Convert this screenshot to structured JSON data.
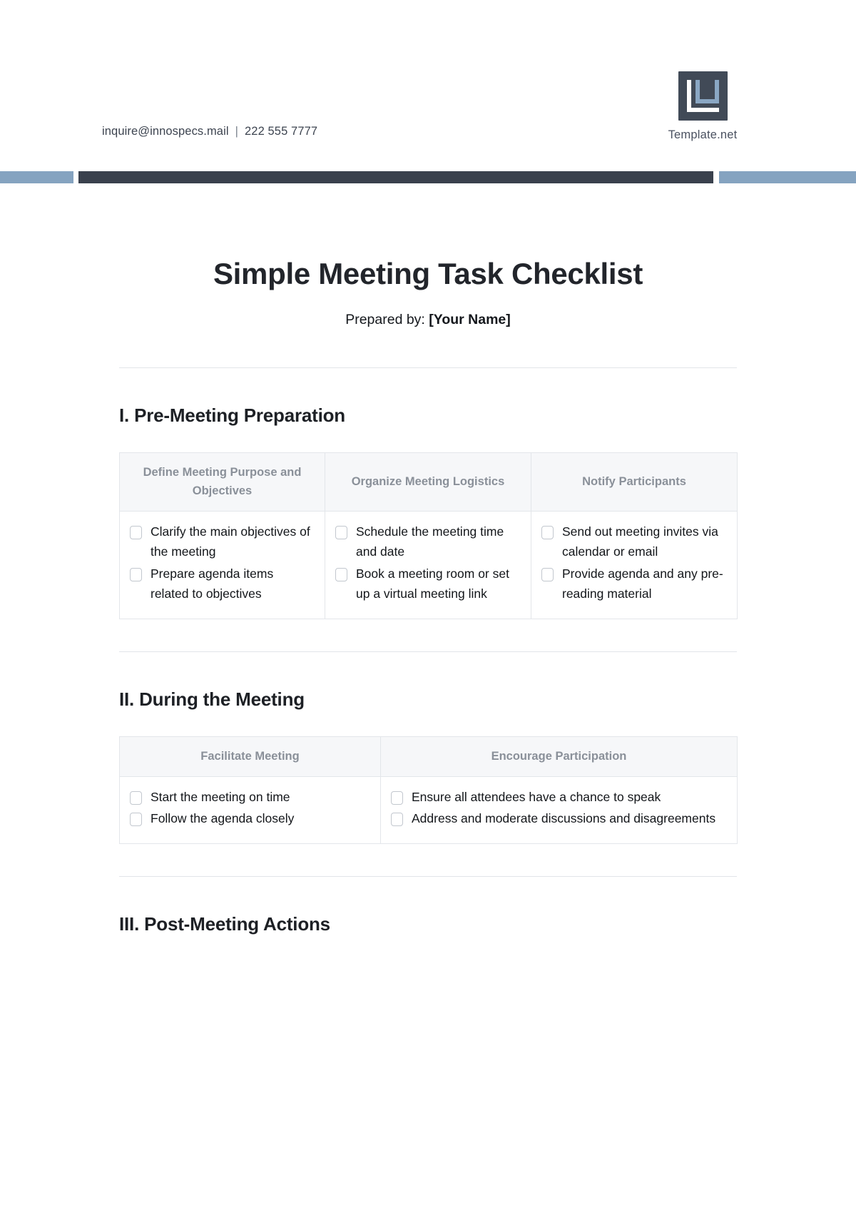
{
  "header": {
    "email": "inquire@innospecs.mail",
    "separator": "|",
    "phone": "222 555 7777",
    "brand_name": "Template.net",
    "logo_icon": "template-net-logo-icon",
    "accent_color": "#85a3c0",
    "dark_color": "#3a414d"
  },
  "document": {
    "title": "Simple Meeting Task Checklist",
    "prepared_by_label": "Prepared by:",
    "prepared_by_value": "[Your Name]"
  },
  "sections": [
    {
      "heading": "I. Pre-Meeting Preparation",
      "columns": [
        {
          "header": "Define Meeting Purpose and Objectives",
          "items": [
            "Clarify the main objectives of the meeting",
            "Prepare agenda items related to objectives"
          ]
        },
        {
          "header": "Organize Meeting Logistics",
          "items": [
            "Schedule the meeting time and date",
            "Book a meeting room or set up a virtual meeting link"
          ]
        },
        {
          "header": "Notify Participants",
          "items": [
            "Send out meeting invites via calendar or email",
            "Provide agenda and any pre-reading material"
          ]
        }
      ]
    },
    {
      "heading": "II. During the Meeting",
      "columns": [
        {
          "header": "Facilitate Meeting",
          "items": [
            "Start the meeting on time",
            "Follow the agenda closely"
          ]
        },
        {
          "header": "Encourage Participation",
          "items": [
            "Ensure all attendees have a chance to speak",
            "Address and moderate discussions and disagreements"
          ]
        }
      ]
    },
    {
      "heading": "III. Post-Meeting Actions",
      "columns": []
    }
  ]
}
